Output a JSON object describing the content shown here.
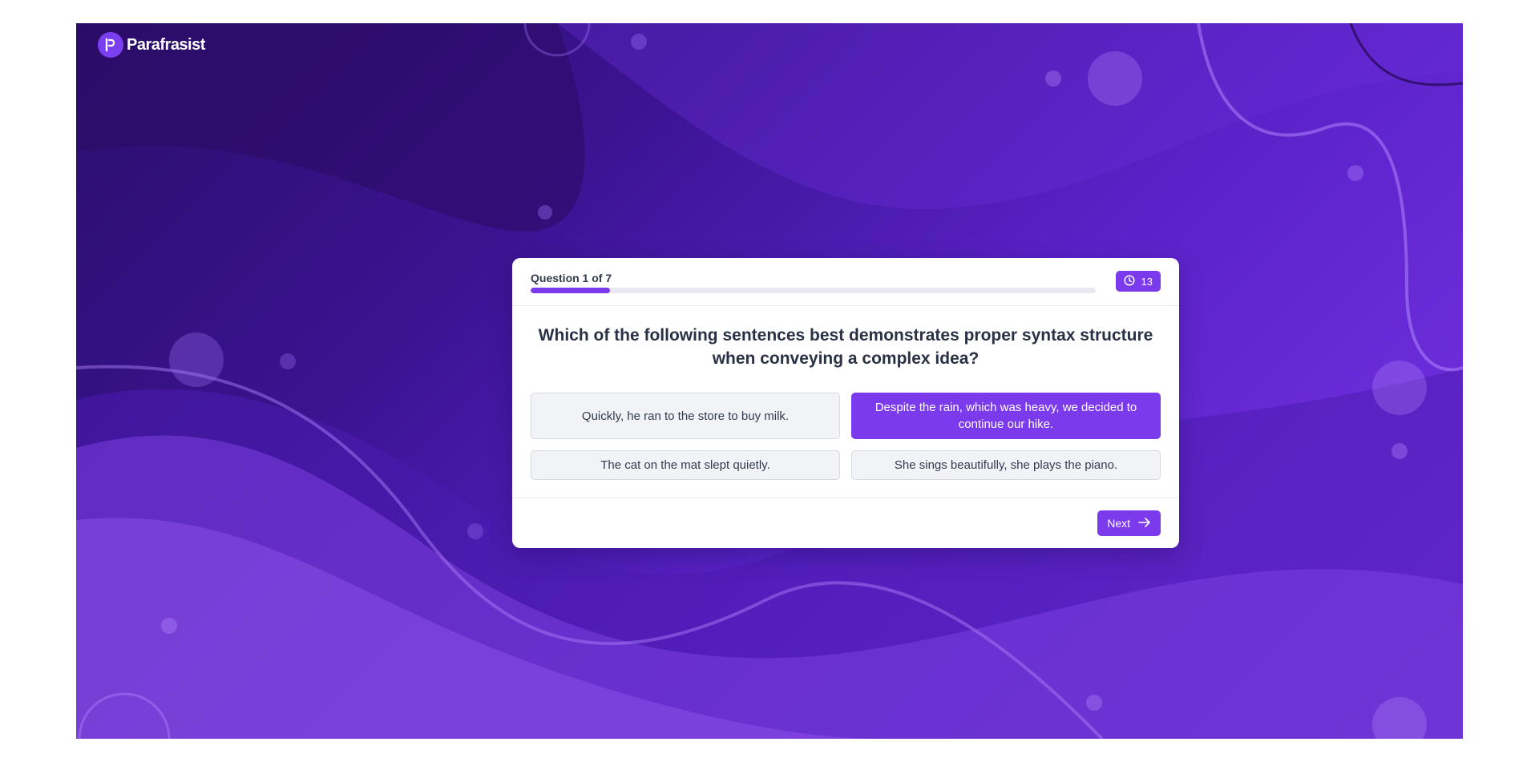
{
  "brand": {
    "name": "Parafrasist",
    "accent": "#7c3aed"
  },
  "quiz": {
    "counter": "Question 1 of 7",
    "progress_fraction": 0.14,
    "timer_icon": "clock-icon",
    "timer_value": "13",
    "question": "Which of the following sentences best demonstrates proper syntax structure when conveying a complex idea?",
    "options": [
      {
        "label": "Quickly, he ran to the store to buy milk.",
        "selected": false
      },
      {
        "label": "Despite the rain, which was heavy, we decided to continue our hike.",
        "selected": true
      },
      {
        "label": "The cat on the mat slept quietly.",
        "selected": false
      },
      {
        "label": "She sings beautifully, she plays the piano.",
        "selected": false
      }
    ],
    "next_label": "Next",
    "next_icon": "arrow-right-icon"
  }
}
